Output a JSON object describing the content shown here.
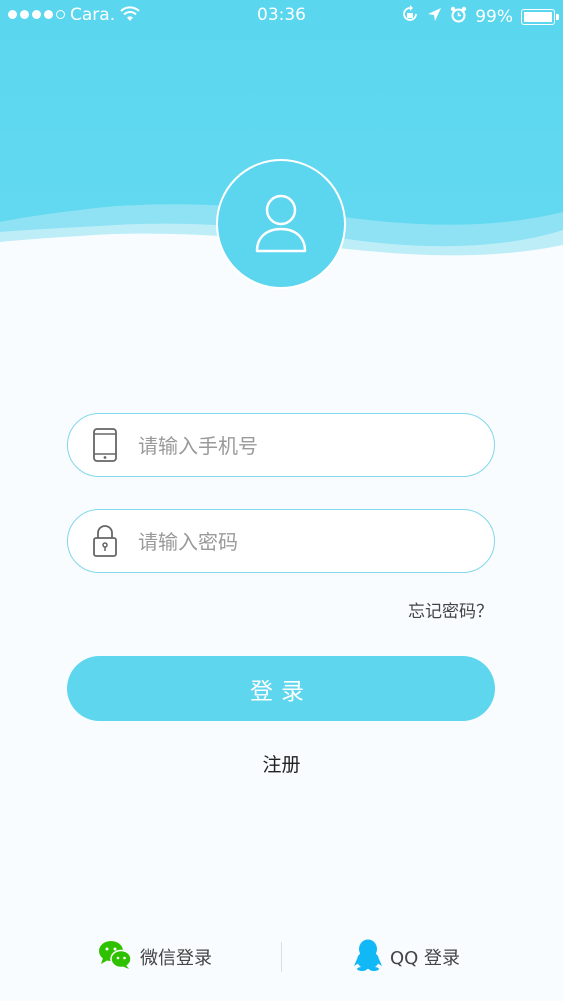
{
  "status_bar": {
    "carrier": "Cara.",
    "time": "03:36",
    "battery": "99%"
  },
  "form": {
    "phone_placeholder": "请输入手机号",
    "password_placeholder": "请输入密码",
    "forgot_label": "忘记密码？",
    "login_label": "登录",
    "register_label": "注册"
  },
  "social": {
    "wechat_label": "微信登录",
    "qq_label": "QQ 登录"
  },
  "colors": {
    "primary": "#5dd6ee",
    "wechat": "#2dc100",
    "qq": "#12b7f5"
  }
}
